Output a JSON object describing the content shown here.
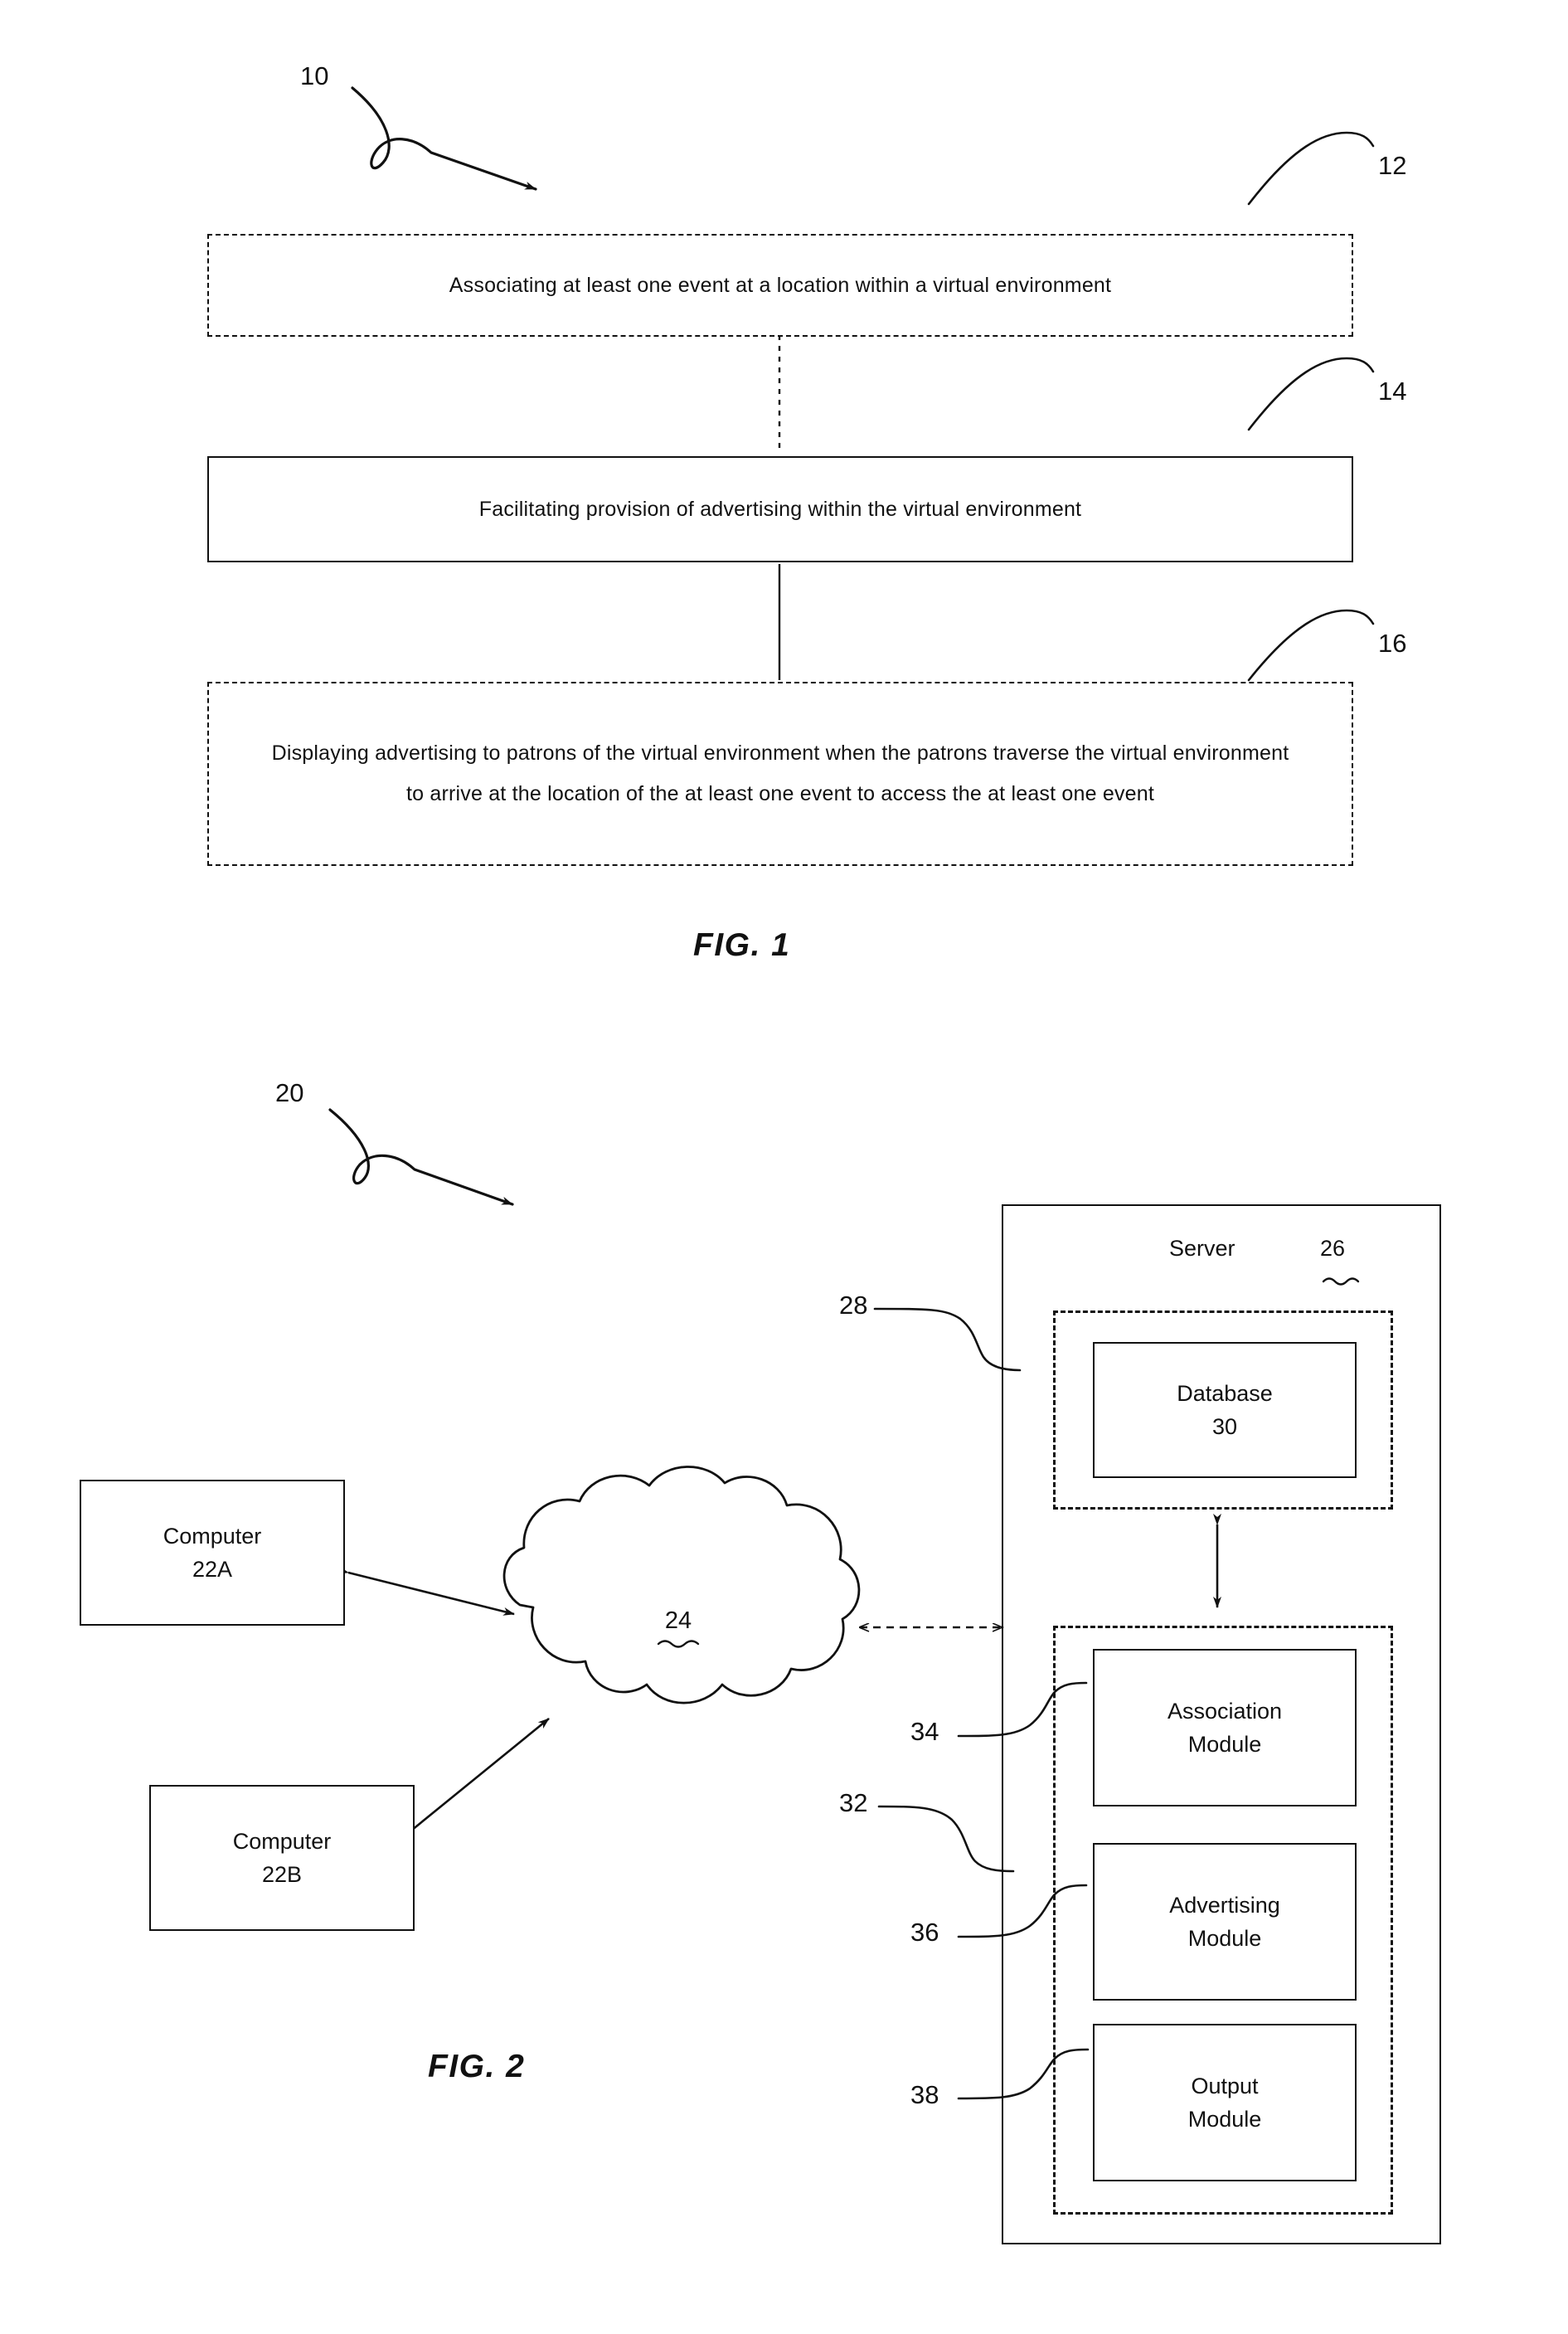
{
  "figure1": {
    "assembly_ref": "10",
    "steps": [
      {
        "ref": "12",
        "text": "Associating at least one event at a location within a virtual environment"
      },
      {
        "ref": "14",
        "text": "Facilitating provision of advertising within the virtual environment"
      },
      {
        "ref": "16",
        "text": "Displaying advertising to patrons of the virtual environment when the patrons traverse the virtual environment to arrive at the location of the at least one event to access the at least one event"
      }
    ],
    "caption": "FIG. 1"
  },
  "figure2": {
    "assembly_ref": "20",
    "caption": "FIG. 2",
    "clients": [
      {
        "label": "Computer",
        "ref": "22A"
      },
      {
        "label": "Computer",
        "ref": "22B"
      }
    ],
    "network": {
      "name": "cloud",
      "ref": "24"
    },
    "server": {
      "title": "Server",
      "ref": "26",
      "outer_group_ref": "28",
      "inner_group_ref": "32",
      "database": {
        "label": "Database",
        "ref": "30"
      },
      "modules": [
        {
          "line1": "Association",
          "line2": "Module",
          "ref": "34"
        },
        {
          "line1": "Advertising",
          "line2": "Module",
          "ref": "36"
        },
        {
          "line1": "Output",
          "line2": "Module",
          "ref": "38"
        }
      ]
    }
  },
  "colors": {
    "ink": "#111111",
    "paper": "#ffffff"
  }
}
